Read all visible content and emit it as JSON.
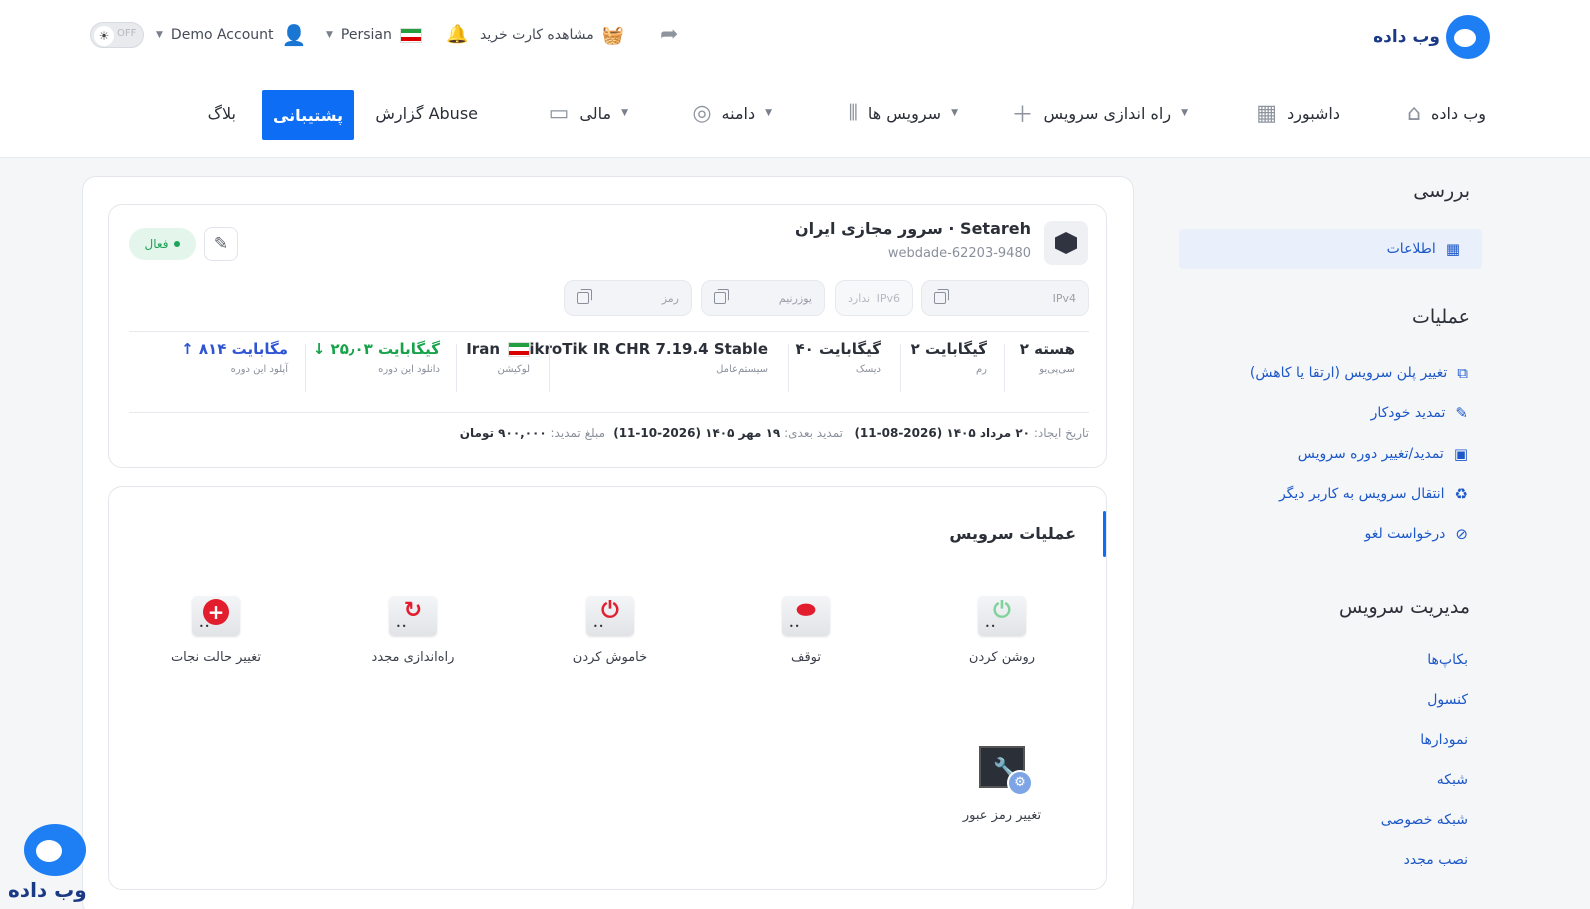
{
  "brand": {
    "name": "وب داده"
  },
  "top_util": {
    "toggle_label": "OFF",
    "account_label": "Demo Account",
    "language_label": "Persian",
    "cart_label": "مشاهده کارت خرید"
  },
  "nav": {
    "items": [
      "وب داده",
      "داشبورد",
      "راه اندازی سرویس",
      "سرویس ها",
      "دامنه",
      "مالی",
      "گزارش Abuse",
      "پشتیبانی",
      "بلاگ"
    ]
  },
  "sidebar": {
    "overview_title": "بررسی",
    "info_label": "اطلاعات",
    "operations_title": "عملیات",
    "operations": [
      "تغییر پلن سرویس (ارتقا یا کاهش)",
      "تمدید خودکار",
      "تمدید/تغییر دوره سرویس",
      "انتقال سرویس به کاربر دیگر",
      "درخواست لغو"
    ],
    "management_title": "مدیریت سرویس",
    "management": [
      "بکاپ‌ها",
      "کنسول",
      "نمودارها",
      "شبکه",
      "شبکه خصوصی",
      "نصب مجدد"
    ]
  },
  "server": {
    "name": "سرور مجازی ایران · Setareh",
    "id": "webdade-62203-9480",
    "status": "فعال",
    "fields": {
      "ipv4": "IPv4",
      "ipv6": "IPv6",
      "ipv6_value": "ندارد",
      "username": "یوزرنیم",
      "password": "رمز"
    },
    "specs": [
      {
        "value": "۲ هسته",
        "label": "سی‌پی‌یو"
      },
      {
        "value": "۲ گیگابایت",
        "label": "رم"
      },
      {
        "value": "۴۰ گیگابایت",
        "label": "دیسک"
      },
      {
        "value": "MikroTik IR CHR 7.19.4 Stable",
        "label": "سیستم‌عامل"
      },
      {
        "value": "Iran",
        "label": "لوکیشن"
      },
      {
        "value": "↓ ۲۵٫۰۳ گیگابایت",
        "label": "دانلود این دوره"
      },
      {
        "value": "↑ ۸۱۴ مگابایت",
        "label": "آپلود این دوره"
      }
    ],
    "dates": {
      "created_label": "تاریخ ایجاد:",
      "created_value": "۲۰ مرداد ۱۴۰۵ (2026-08-11)",
      "next_label": "تمدید بعدی:",
      "next_value": "۱۹ مهر ۱۴۰۵ (2026-10-11)",
      "amount_label": "مبلغ تمدید:",
      "amount_value": "۹۰۰,۰۰۰ تومان"
    }
  },
  "service_ops": {
    "title": "عملیات سرویس",
    "items": [
      "روشن کردن",
      "توقف",
      "خاموش کردن",
      "راه‌اندازی مجدد",
      "تغییر حالت نجات",
      "تغییر رمز عبور"
    ]
  },
  "colors": {
    "primary": "#0d6ef5",
    "link": "#1d58c9",
    "success": "#1ea35a",
    "download": "#16a34a",
    "upload": "#2f55d4"
  }
}
